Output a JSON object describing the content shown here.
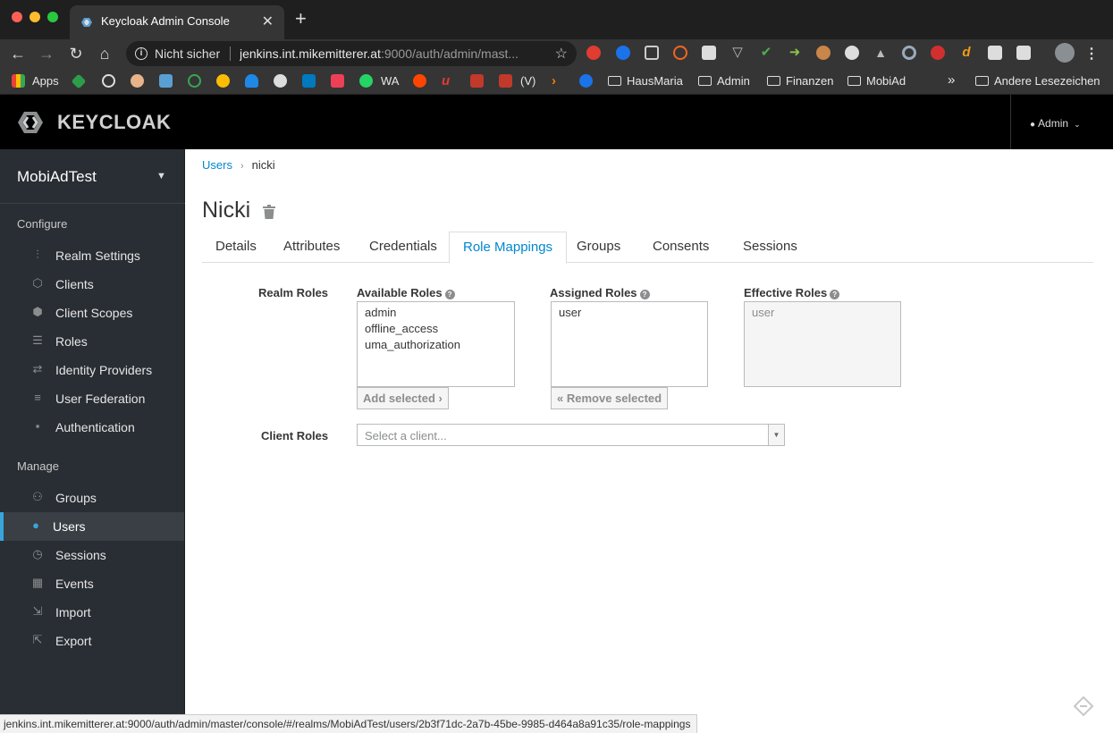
{
  "browser": {
    "tab_title": "Keycloak Admin Console",
    "omnibox": {
      "security_label": "Nicht sicher",
      "url_host": "jenkins.int.mikemitterer.at",
      "url_rest": ":9000/auth/admin/mast..."
    },
    "bookmarks": {
      "apps": "Apps",
      "wa": "WA",
      "v": "(V)",
      "folders": [
        "HausMaria",
        "Admin",
        "Finanzen",
        "MobiAd"
      ],
      "overflow": "»",
      "other": "Andere Lesezeichen"
    },
    "status_url": "jenkins.int.mikemitterer.at:9000/auth/admin/master/console/#/realms/MobiAdTest/users/2b3f71dc-2a7b-45be-9985-d464a8a91c35/role-mappings"
  },
  "header": {
    "logo_text": "KEYCLOAK",
    "user_label": "Admin"
  },
  "sidebar": {
    "realm": "MobiAdTest",
    "configure_title": "Configure",
    "configure_items": [
      {
        "label": "Realm Settings",
        "icon": "sliders-icon"
      },
      {
        "label": "Clients",
        "icon": "cube-icon"
      },
      {
        "label": "Client Scopes",
        "icon": "cubes-icon"
      },
      {
        "label": "Roles",
        "icon": "list-icon"
      },
      {
        "label": "Identity Providers",
        "icon": "exchange-icon"
      },
      {
        "label": "User Federation",
        "icon": "database-icon"
      },
      {
        "label": "Authentication",
        "icon": "lock-icon"
      }
    ],
    "manage_title": "Manage",
    "manage_items": [
      {
        "label": "Groups",
        "icon": "users-icon"
      },
      {
        "label": "Users",
        "icon": "user-icon"
      },
      {
        "label": "Sessions",
        "icon": "clock-icon"
      },
      {
        "label": "Events",
        "icon": "calendar-icon"
      },
      {
        "label": "Import",
        "icon": "import-icon"
      },
      {
        "label": "Export",
        "icon": "export-icon"
      }
    ],
    "active_item": "Users"
  },
  "main": {
    "breadcrumb": {
      "parent": "Users",
      "current": "nicki"
    },
    "title": "Nicki",
    "tabs": [
      "Details",
      "Attributes",
      "Credentials",
      "Role Mappings",
      "Groups",
      "Consents",
      "Sessions"
    ],
    "active_tab": "Role Mappings",
    "realm_roles_label": "Realm Roles",
    "available_roles_label": "Available Roles",
    "assigned_roles_label": "Assigned Roles",
    "effective_roles_label": "Effective Roles",
    "available_roles": [
      "admin",
      "offline_access",
      "uma_authorization"
    ],
    "assigned_roles": [
      "user"
    ],
    "effective_roles": [
      "user"
    ],
    "add_selected_label": "Add selected ›",
    "remove_selected_label": "« Remove selected",
    "client_roles_label": "Client Roles",
    "client_select_placeholder": "Select a client..."
  },
  "colors": {
    "accent": "#0088ce",
    "sidebar_bg": "#292e34",
    "active_indicator": "#39a5dc",
    "header_bg": "#000000"
  }
}
